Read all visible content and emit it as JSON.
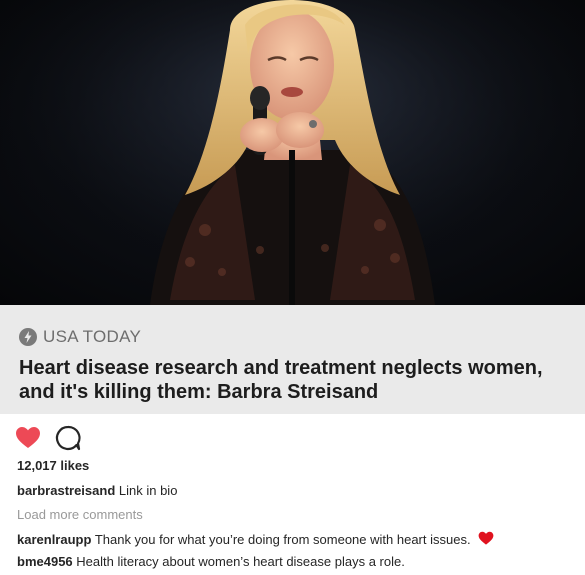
{
  "post": {
    "photo_alt": "Barbra Streisand",
    "card": {
      "source": "USA TODAY",
      "source_icon": "lightning-bolt-icon",
      "headline": "Heart disease research and treatment neglects women, and it's killing them: Barbra Streisand"
    },
    "actions": {
      "like_icon": "heart-icon",
      "comment_icon": "comment-bubble-icon",
      "liked": true
    },
    "likes": "12,017 likes",
    "caption": {
      "username": "barbrastreisand",
      "text": "Link in bio"
    },
    "load_more": "Load more comments",
    "comments": [
      {
        "username": "karenlraupp",
        "text": "Thank you for what you’re doing from someone with heart issues.",
        "emoji": "red-heart-emoji"
      },
      {
        "username": "bme4956",
        "text": "Health literacy about women’s heart disease plays a role."
      }
    ],
    "colors": {
      "like_red": "#ed4956",
      "card_bg": "#eaeaea",
      "muted_text": "#999999"
    }
  }
}
